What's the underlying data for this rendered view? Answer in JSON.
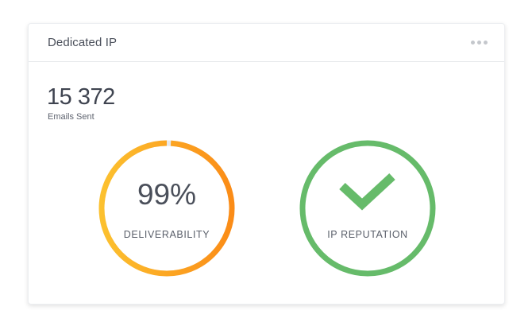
{
  "card": {
    "title": "Dedicated IP",
    "menu_icon": "more-horizontal-icon"
  },
  "emails": {
    "count": "15 372",
    "label": "Emails Sent"
  },
  "deliverability": {
    "value_text": "99%",
    "value": 0.99,
    "label": "DELIVERABILITY",
    "colors": {
      "start": "#fcc12f",
      "end": "#fb8c17",
      "track": "#e6e8eb"
    }
  },
  "reputation": {
    "label": "IP REPUTATION",
    "icon": "checkmark-icon",
    "color": "#66bb6a"
  }
}
